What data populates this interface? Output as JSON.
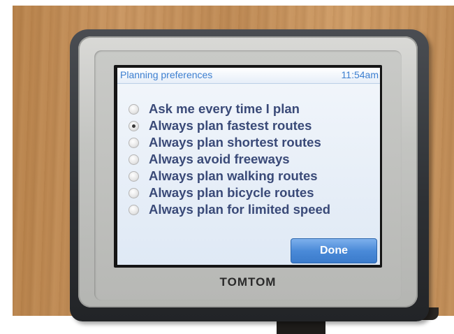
{
  "device": {
    "brand": "TOMTOM"
  },
  "header": {
    "title": "Planning preferences",
    "time": "11:54am"
  },
  "options": [
    {
      "label": "Ask me every time I plan",
      "selected": false
    },
    {
      "label": "Always plan fastest routes",
      "selected": true
    },
    {
      "label": "Always plan shortest routes",
      "selected": false
    },
    {
      "label": "Always avoid freeways",
      "selected": false
    },
    {
      "label": "Always plan walking routes",
      "selected": false
    },
    {
      "label": "Always plan bicycle routes",
      "selected": false
    },
    {
      "label": "Always plan for limited speed",
      "selected": false
    }
  ],
  "actions": {
    "done_label": "Done"
  },
  "colors": {
    "accent": "#3d7fd0",
    "label_text": "#3a4a78",
    "button": "#4a8ad8"
  }
}
